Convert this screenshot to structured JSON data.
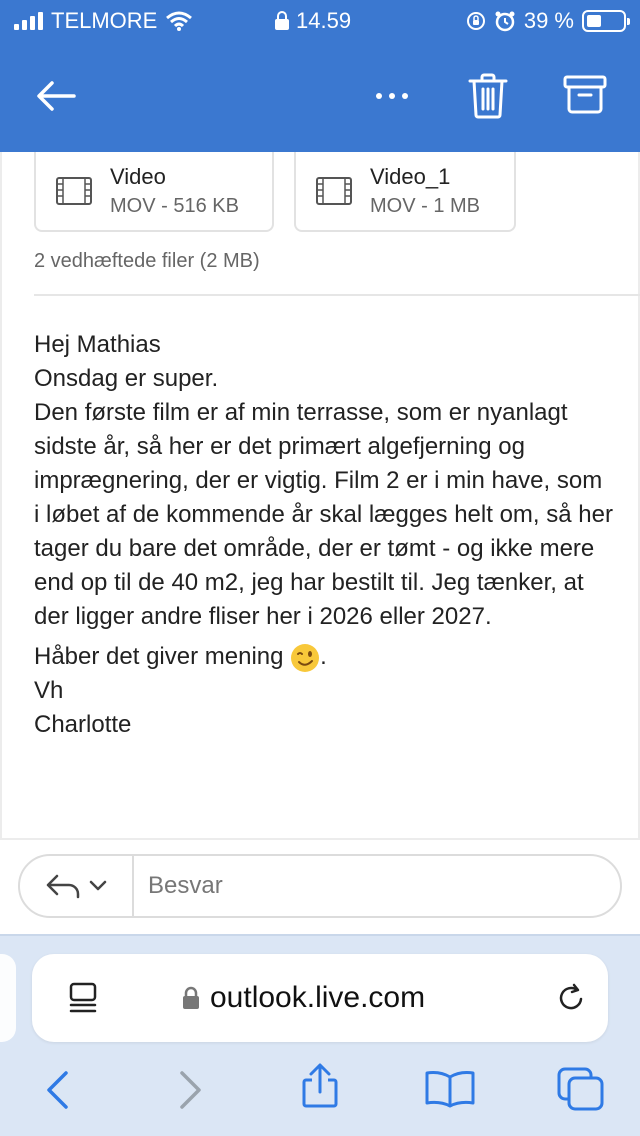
{
  "status": {
    "carrier": "TELMORE",
    "time": "14.59",
    "battery": "39 %"
  },
  "toolbar": {
    "back_label": "Back",
    "more_label": "More",
    "delete_label": "Delete",
    "archive_label": "Archive"
  },
  "attachments": {
    "items": [
      {
        "name": "Video",
        "meta": "MOV - 516 KB"
      },
      {
        "name": "Video_1",
        "meta": "MOV - 1 MB"
      }
    ],
    "summary": "2 vedhæftede filer (2 MB)"
  },
  "email": {
    "greeting": "Hej Mathias",
    "line1": "Onsdag er super.",
    "paragraph": "Den første film er af min terrasse, som er nyanlagt sidste år, så her er det primært algefjerning og imprægnering, der er vigtig. Film 2 er i min have, som i løbet af de kommende år skal lægges helt om, så her tager du bare det område, der er tømt - og ikke mere end op til de 40 m2, jeg har bestilt til. Jeg tænker, at der ligger andre fliser her i 2026 eller 2027.",
    "closing_text": "Håber det giver mening",
    "closing_punct": ".",
    "signoff": "Vh",
    "signature": "Charlotte"
  },
  "reply": {
    "placeholder": "Besvar"
  },
  "safari": {
    "url": "outlook.live.com"
  },
  "colors": {
    "brand_blue": "#3b78d0",
    "safari_blue": "#2f7ae5"
  }
}
